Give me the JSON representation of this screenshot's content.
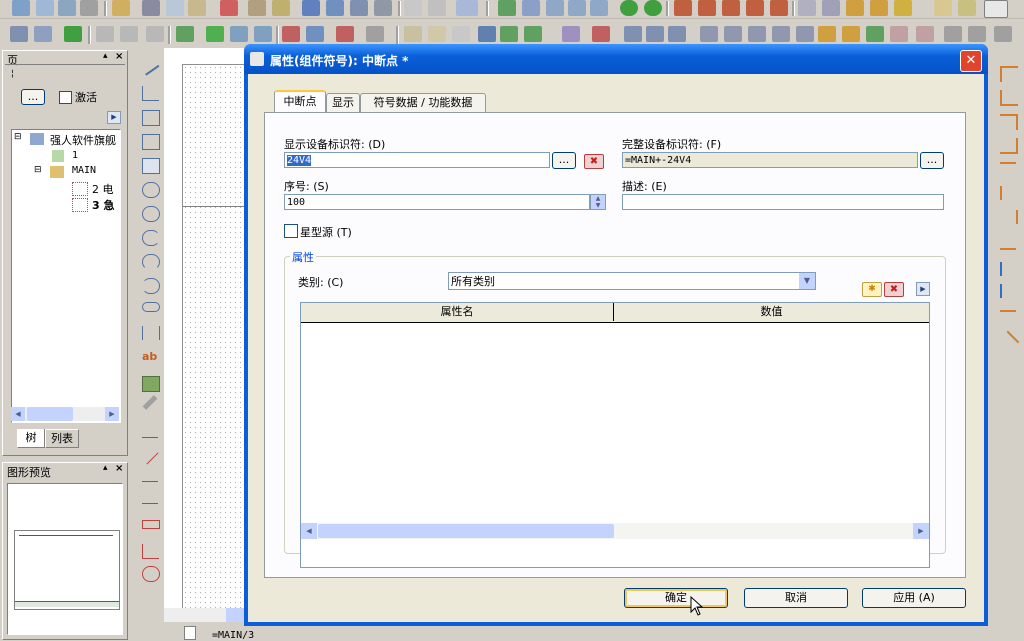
{
  "left_panel": {
    "title": "页",
    "activate_label": "激活",
    "activate_button": "...",
    "tree": {
      "root": "强人软件旗舰",
      "page_1": "1",
      "main": "MAIN",
      "page_2": "2 电",
      "page_3": "3 急"
    },
    "tabs": [
      "树",
      "列表"
    ]
  },
  "preview_panel": {
    "title": "图形预览"
  },
  "status_tab": "=MAIN/3",
  "dialog": {
    "title": "属性(组件符号): 中断点 *",
    "tabs": [
      "中断点",
      "显示",
      "符号数据 / 功能数据"
    ],
    "display_id_label": "显示设备标识符: (D)",
    "display_id_value": "24V4",
    "full_id_label": "完整设备标识符: (F)",
    "full_id_value": "=MAIN+-24V4",
    "seq_label": "序号: (S)",
    "seq_value": "100",
    "desc_label": "描述: (E)",
    "desc_value": "",
    "star_source_label": "星型源 (T)",
    "attributes_group": "属性",
    "category_label": "类别: (C)",
    "category_value": "所有类别",
    "table_headers": [
      "属性名",
      "数值"
    ],
    "ellipsis": "...",
    "ok": "确定",
    "cancel": "取消",
    "apply": "应用 (A)"
  },
  "colors": {
    "title_bar": "#0a5fd8",
    "title_bar_light": "#3d95ff",
    "close_red": "#e0452c",
    "selection": "#316ac5"
  }
}
